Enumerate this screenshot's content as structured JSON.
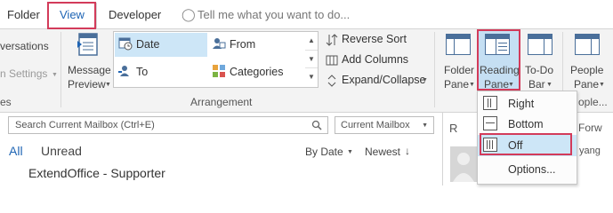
{
  "tabs": {
    "folder": "Folder",
    "view": "View",
    "developer": "Developer"
  },
  "tell_me": "Tell me what you want to do...",
  "ribbon": {
    "conversations_label": "versations",
    "conv_settings_label": "n Settings",
    "conv_group_label": "es",
    "message_preview": {
      "line1": "Message",
      "line2": "Preview"
    },
    "arrangement": {
      "items": [
        "Date",
        "From",
        "To",
        "Categories"
      ],
      "group_label": "Arrangement"
    },
    "reverse_sort": "Reverse Sort",
    "add_columns": "Add Columns",
    "expand_collapse": "Expand/Collapse",
    "folder_pane": {
      "line1": "Folder",
      "line2": "Pane"
    },
    "reading_pane": {
      "line1": "Reading",
      "line2": "Pane"
    },
    "todo_bar": {
      "line1": "To-Do",
      "line2": "Bar"
    },
    "people_pane": {
      "line1": "People",
      "line2": "Pane"
    },
    "people_group_partial": "ople..."
  },
  "search": {
    "placeholder": "Search Current Mailbox (Ctrl+E)",
    "scope": "Current Mailbox"
  },
  "message_list": {
    "filter_all": "All",
    "filter_unread": "Unread",
    "sort_by": "By Date",
    "sort_order": "Newest",
    "first_sender": "ExtendOffice - Supporter"
  },
  "reading_partial": {
    "reply": "R",
    "forward": "Forw",
    "name": "yang"
  },
  "reading_pane_menu": {
    "items": [
      "Right",
      "Bottom",
      "Off",
      "Options..."
    ],
    "selected": "Off"
  },
  "colors": {
    "highlight_red": "#d33b5a",
    "accent_blue": "#1e64b4",
    "selected_bg": "#cde6f7"
  }
}
